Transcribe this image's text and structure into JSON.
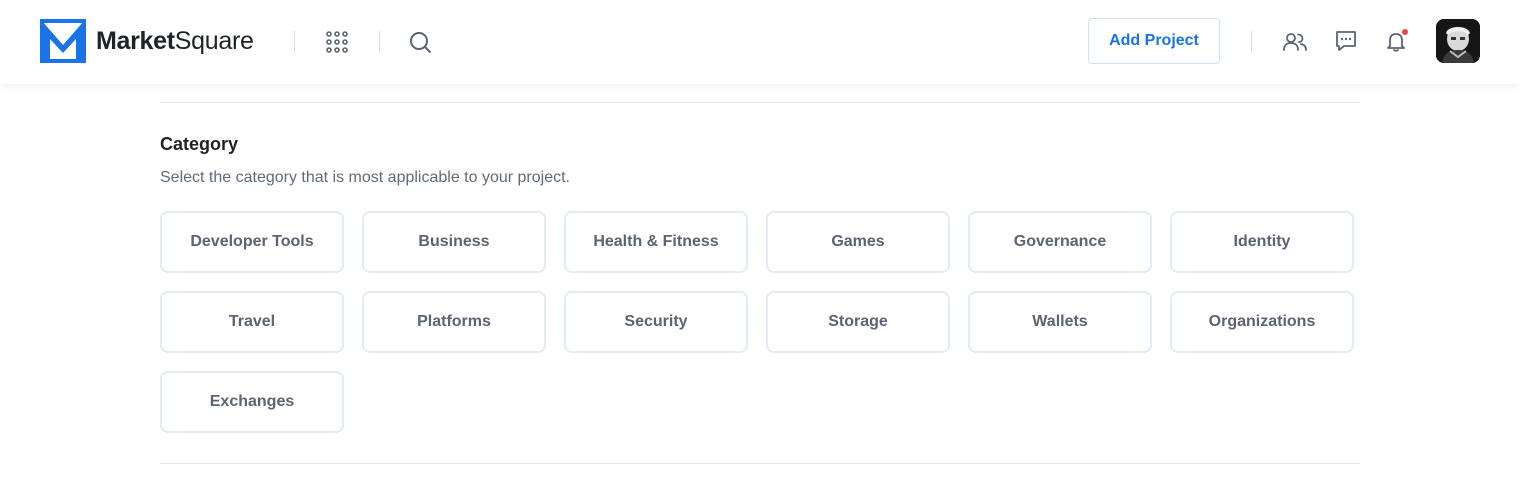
{
  "brand": {
    "name_bold": "Market",
    "name_regular": "Square",
    "accent_color": "#1a73e8"
  },
  "header": {
    "add_project_label": "Add Project",
    "notification_dot_color": "#e8453c"
  },
  "category": {
    "title": "Category",
    "description": "Select the category that is most applicable to your project.",
    "options": [
      "Developer Tools",
      "Business",
      "Health & Fitness",
      "Games",
      "Governance",
      "Identity",
      "Travel",
      "Platforms",
      "Security",
      "Storage",
      "Wallets",
      "Organizations",
      "Exchanges"
    ]
  }
}
